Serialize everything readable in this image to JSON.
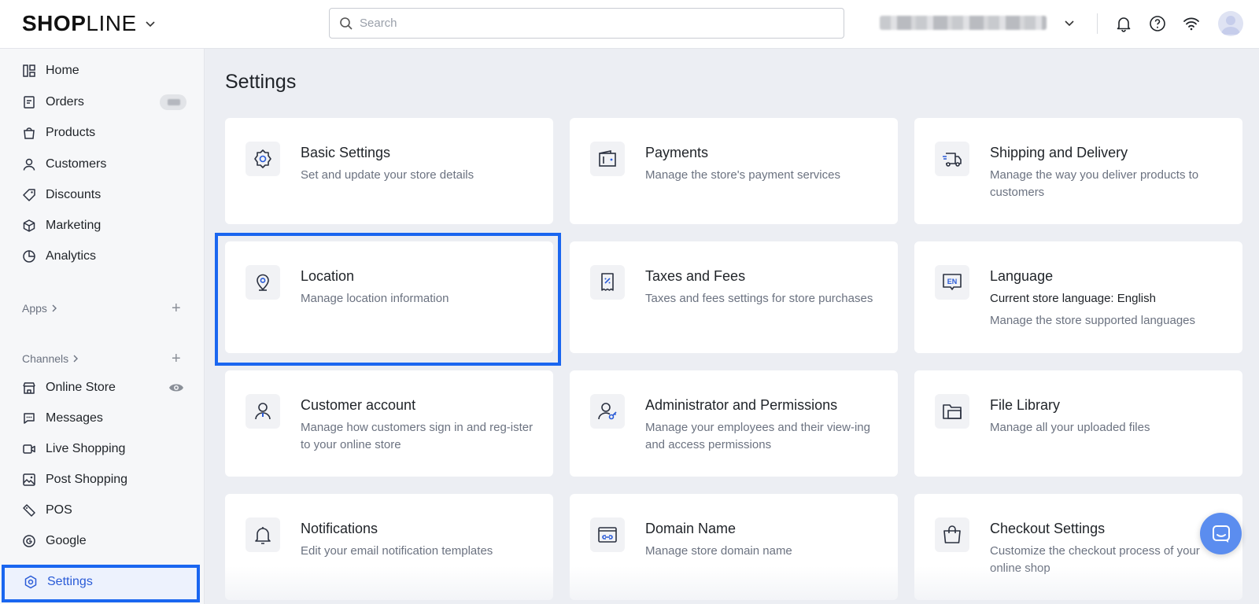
{
  "header": {
    "logo": "SHOPLINE",
    "search_placeholder": "Search",
    "icons": [
      "chevron-down-icon",
      "search-icon",
      "bell-icon",
      "help-icon",
      "wifi-icon",
      "avatar-icon"
    ]
  },
  "sidebar": {
    "items": [
      {
        "label": "Home",
        "icon": "home-icon"
      },
      {
        "label": "Orders",
        "icon": "orders-icon"
      },
      {
        "label": "Products",
        "icon": "bag-icon"
      },
      {
        "label": "Customers",
        "icon": "user-icon"
      },
      {
        "label": "Discounts",
        "icon": "tag-icon"
      },
      {
        "label": "Marketing",
        "icon": "cube-icon"
      },
      {
        "label": "Analytics",
        "icon": "pie-icon"
      }
    ],
    "apps_label": "Apps",
    "channels_label": "Channels",
    "channels": [
      {
        "label": "Online Store",
        "icon": "store-icon"
      },
      {
        "label": "Messages",
        "icon": "chat-icon"
      },
      {
        "label": "Live Shopping",
        "icon": "video-icon"
      },
      {
        "label": "Post Shopping",
        "icon": "image-icon"
      },
      {
        "label": "POS",
        "icon": "pos-icon"
      },
      {
        "label": "Google",
        "icon": "google-icon"
      }
    ],
    "settings_label": "Settings"
  },
  "main": {
    "title": "Settings",
    "cards": [
      {
        "title": "Basic Settings",
        "desc": "Set and update your store details"
      },
      {
        "title": "Payments",
        "desc": "Manage the store's payment services"
      },
      {
        "title": "Shipping and Delivery",
        "desc": "Manage the way you deliver products to customers"
      },
      {
        "title": "Location",
        "desc": "Manage location information"
      },
      {
        "title": "Taxes and Fees",
        "desc": "Taxes and fees settings for store purchases"
      },
      {
        "title": "Language",
        "desc_dark": "Current store language: English",
        "desc": "Manage the store supported languages"
      },
      {
        "title": "Customer account",
        "desc": "Manage how customers sign in and reg-ister to your online store"
      },
      {
        "title": "Administrator and Permissions",
        "desc": "Manage your employees and their view-ing and access permissions"
      },
      {
        "title": "File Library",
        "desc": "Manage all your uploaded files"
      },
      {
        "title": "Notifications",
        "desc": "Edit your email notification templates"
      },
      {
        "title": "Domain Name",
        "desc": "Manage store domain name"
      },
      {
        "title": "Checkout Settings",
        "desc": "Customize the checkout process of your online shop"
      }
    ]
  },
  "colors": {
    "accent": "#1a66f0",
    "icon_stroke": "#2b3140",
    "icon_accent": "#2a5bd7",
    "page_bg": "#eceef3"
  }
}
